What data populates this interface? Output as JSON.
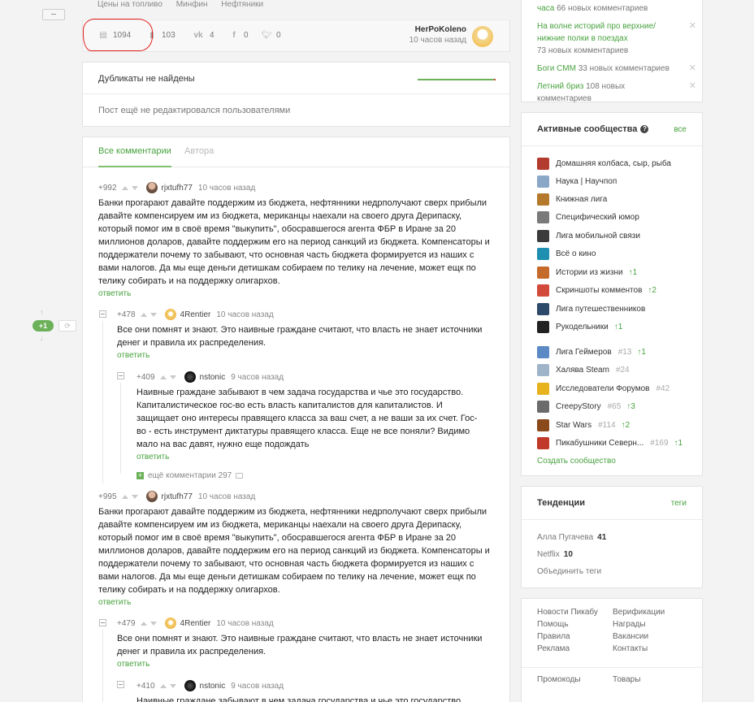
{
  "story": {
    "tags": [
      "Цены на топливо",
      "Минфин",
      "Нефтяники"
    ],
    "comments_count": "1094",
    "saves_count": "103",
    "vk_count": "4",
    "fb_count": "0",
    "tw_count": "0",
    "author": "HerPoKoleno",
    "time": "10 часов назад"
  },
  "duplicates": {
    "title": "Дубликаты не найдены",
    "note": "Пост ещё не редактировался пользователями"
  },
  "tabs": {
    "all": "Все комментарии",
    "author": "Автора"
  },
  "reply_label": "ответить",
  "nav": {
    "new_count": "+1"
  },
  "comments": [
    {
      "rating": "+992",
      "user": "rjxtufh77",
      "time": "10 часов назад",
      "text": "Банки прогарают давайте поддержим из бюджета, нефтянники недрполучают сверх прибыли давайте компенсируем им из бюджета, мериканцы наехали на своего друга Дерипаску, который помог им в своё время \"выкупить\", обосравшегося агента ФБР в Иране за 20 миллионов доларов, давайте поддержим его на период санкций из бюджета. Компенсаторы и поддержатели почему то забывают, что основная часть бюджета формируется из наших с вами налогов. Да мы еще деньги детишкам собираем по телику на лечение, может ещк по телику собирать и на поддержку олигархов."
    },
    {
      "rating": "+478",
      "user": "4Rentier",
      "time": "10 часов назад",
      "text": "Все они помнят и знают. Это наивные граждане считают, что власть не знает источники денег и правила их распределения."
    },
    {
      "rating": "+409",
      "user": "nstonic",
      "time": "9 часов назад",
      "text": "Наивные граждане забывают в чем задача государства и чье это государство. Капиталистическое гос-во есть власть капиталистов для капиталистов. И защищает оно интересы правящего класса за ваш счет, а не ваши за их счет. Гос-во - есть инструмент диктатуры правящего класса. Еще не все поняли? Видимо мало на вас давят, нужно еще подождать"
    },
    {
      "more": "ещё комментарии 297"
    },
    {
      "rating": "+995",
      "user": "rjxtufh77",
      "time": "10 часов назад",
      "text": "Банки прогарают давайте поддержим из бюджета, нефтянники недрполучают сверх прибыли давайте компенсируем им из бюджета, мериканцы наехали на своего друга Дерипаску, который помог им в своё время \"выкупить\", обосравшегося агента ФБР в Иране за 20 миллионов доларов, давайте поддержим его на период санкций из бюджета. Компенсаторы и поддержатели почему то забывают, что основная часть бюджета формируется из наших с вами налогов. Да мы еще деньги детишкам собираем по телику на лечение, может ещк по телику собирать и на поддержку олигархов."
    },
    {
      "rating": "+479",
      "user": "4Rentier",
      "time": "10 часов назад",
      "text": "Все они помнят и знают. Это наивные граждане считают, что власть не знает источники денег и правила их распределения."
    },
    {
      "rating": "+410",
      "user": "nstonic",
      "time": "9 часов назад",
      "text": "Наивные граждане забывают в чем задача государства и чье это государство."
    }
  ],
  "hot": [
    {
      "title": "часа",
      "count": "66 новых комментариев"
    },
    {
      "title": "На волне историй про верхние/нижние полки в поездах",
      "count": "73 новых комментариев"
    },
    {
      "title": "Боги СММ",
      "count": "33 новых комментариев"
    },
    {
      "title": "Летний бриз",
      "count": "108 новых комментариев"
    }
  ],
  "communities": {
    "title": "Активные сообщества",
    "all_link": "все",
    "create": "Создать сообщество",
    "items": [
      {
        "name": "Домашняя колбаса, сыр, рыба",
        "color": "#b33a2e"
      },
      {
        "name": "Наука | Научпоп",
        "color": "#8aa7c7"
      },
      {
        "name": "Книжная лига",
        "color": "#b5792c"
      },
      {
        "name": "Специфический юмор",
        "color": "#7a7a7a"
      },
      {
        "name": "Лига мобильной связи",
        "color": "#3b3b3b"
      },
      {
        "name": "Всё о кино",
        "color": "#1e8fb0"
      },
      {
        "name": "Истории из жизни",
        "up": "1",
        "color": "#c46a2a"
      },
      {
        "name": "Скриншоты комментов",
        "up": "2",
        "color": "#d14a3a"
      },
      {
        "name": "Лига путешественников",
        "color": "#2e4a6b"
      },
      {
        "name": "Рукодельники",
        "up": "1",
        "color": "#222222"
      },
      {
        "name": "Лига Геймеров",
        "rank": "#13",
        "up": "1",
        "color": "#5b8ac4"
      },
      {
        "name": "Халява Steam",
        "rank": "#24",
        "color": "#9fb4c9"
      },
      {
        "name": "Исследователи Форумов",
        "rank": "#42",
        "color": "#e6b21e"
      },
      {
        "name": "CreepyStory",
        "rank": "#65",
        "up": "3",
        "color": "#6b6b6b"
      },
      {
        "name": "Star Wars",
        "rank": "#114",
        "up": "2",
        "color": "#8a4a1c"
      },
      {
        "name": "Пикабушники Северн...",
        "rank": "#169",
        "up": "1",
        "color": "#c0392b"
      }
    ]
  },
  "trends": {
    "title": "Тенденции",
    "link": "теги",
    "items": [
      {
        "name": "Алла Пугачева",
        "count": "41"
      },
      {
        "name": "Netflix",
        "count": "10"
      }
    ],
    "merge": "Объединить теги"
  },
  "footer_links": {
    "col1": [
      "Новости Пикабу",
      "Помощь",
      "Правила",
      "Реклама"
    ],
    "col2": [
      "Верификации",
      "Награды",
      "Вакансии",
      "Контакты"
    ],
    "promo": "Промокоды",
    "goods": "Товары"
  }
}
